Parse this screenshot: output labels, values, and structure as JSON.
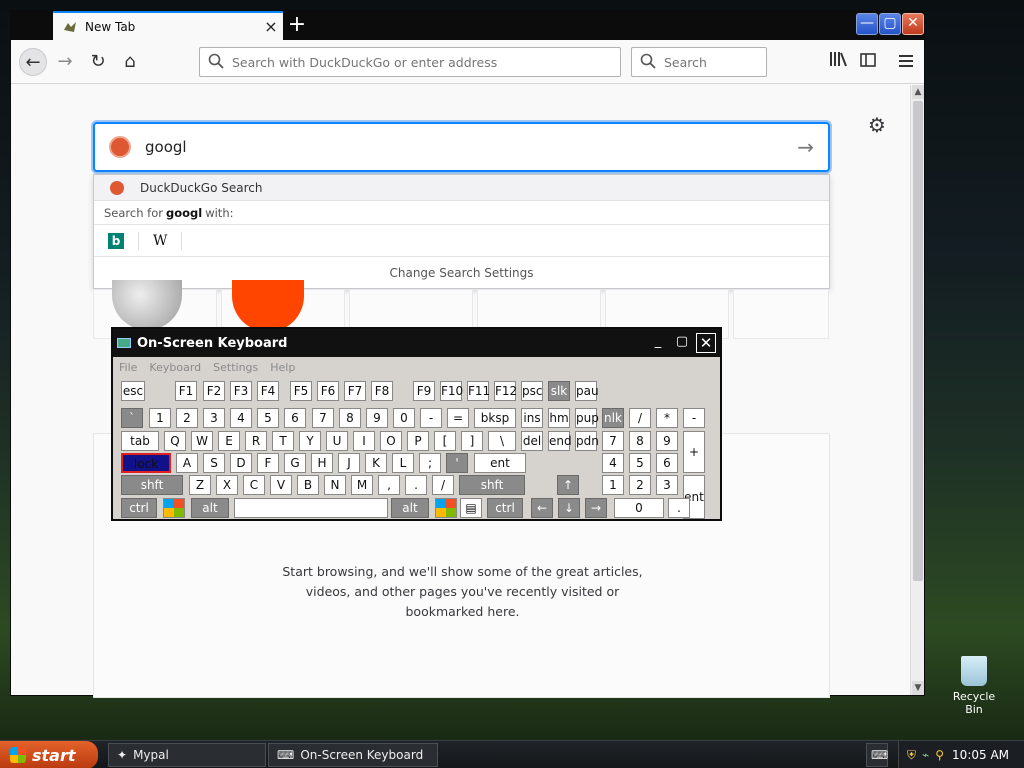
{
  "browser": {
    "tab": {
      "title": "New Tab",
      "close": "×"
    },
    "new_tab": "+",
    "window_controls": {
      "minimize": "—",
      "maximize": "▢",
      "close": "✕"
    },
    "nav": {
      "back": "←",
      "forward": "→",
      "reload": "↻",
      "home": "⌂"
    },
    "urlbar_placeholder": "Search with DuckDuckGo or enter address",
    "searchbox_placeholder": "Search",
    "toolbar_icons": [
      "library-icon",
      "sidebar-icon",
      "menu-icon"
    ]
  },
  "newtab": {
    "search_value": "googl",
    "go_arrow": "→",
    "dropdown": {
      "engine_row": "DuckDuckGo Search",
      "search_for_prefix": "Search for",
      "search_for_term": "googl",
      "search_for_suffix": "with:",
      "engines": [
        "bing-icon",
        "wikipedia-icon"
      ],
      "bing_glyph": "b",
      "wiki_glyph": "W",
      "settings": "Change Search Settings"
    },
    "empty_message_line1": "Start browsing, and we'll show some of the great articles,",
    "empty_message_line2": "videos, and other pages you've recently visited or",
    "empty_message_line3": "bookmarked here.",
    "gear": "⚙"
  },
  "osk": {
    "title": "On-Screen Keyboard",
    "menu": [
      "File",
      "Keyboard",
      "Settings",
      "Help"
    ],
    "row0": [
      "esc",
      "F1",
      "F2",
      "F3",
      "F4",
      "F5",
      "F6",
      "F7",
      "F8",
      "F9",
      "F10",
      "F11",
      "F12",
      "psc",
      "slk",
      "pau"
    ],
    "row1": [
      "`",
      "1",
      "2",
      "3",
      "4",
      "5",
      "6",
      "7",
      "8",
      "9",
      "0",
      "-",
      "=",
      "bksp",
      "ins",
      "hm",
      "pup",
      "nlk",
      "/",
      "*",
      "-"
    ],
    "row2": [
      "tab",
      "Q",
      "W",
      "E",
      "R",
      "T",
      "Y",
      "U",
      "I",
      "O",
      "P",
      "[",
      "]",
      "\\",
      "del",
      "end",
      "pdn",
      "7",
      "8",
      "9",
      "+"
    ],
    "row3": [
      "lock",
      "A",
      "S",
      "D",
      "F",
      "G",
      "H",
      "J",
      "K",
      "L",
      ";",
      "'",
      "ent",
      "4",
      "5",
      "6"
    ],
    "row4": [
      "shft",
      "Z",
      "X",
      "C",
      "V",
      "B",
      "N",
      "M",
      ",",
      ".",
      "/",
      "shft",
      "↑",
      "1",
      "2",
      "3",
      "ent"
    ],
    "row5": [
      "ctrl",
      "alt",
      "alt",
      "ctrl",
      "←",
      "↓",
      "→",
      "0",
      "."
    ]
  },
  "desktop": {
    "recycle_bin": "Recycle Bin"
  },
  "taskbar": {
    "start": "start",
    "tasks": [
      "Mypal",
      "On-Screen Keyboard"
    ],
    "clock": "10:05 AM"
  }
}
